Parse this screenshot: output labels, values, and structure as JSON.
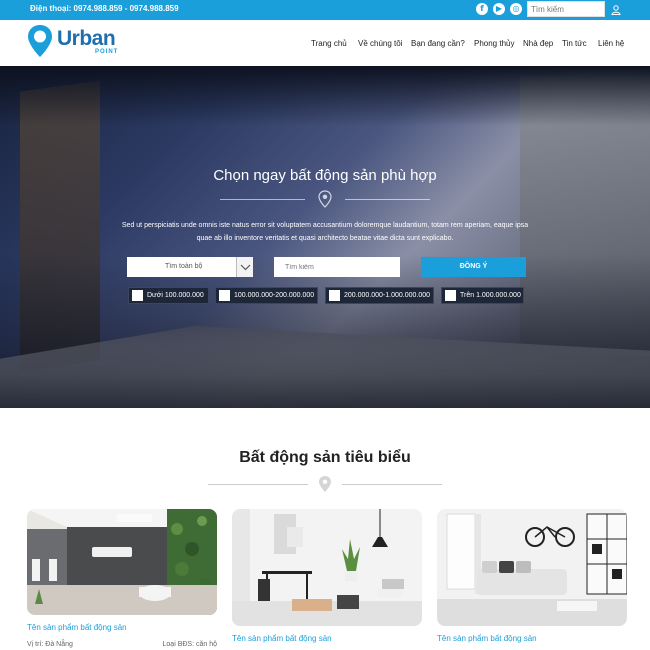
{
  "topbar": {
    "phone": "Điện thoại: 0974.988.859 - 0974.988.859",
    "social_icons": [
      "facebook-icon",
      "youtube-icon",
      "instagram-icon"
    ],
    "search_placeholder": "Tìm kiếm"
  },
  "brand": {
    "name": "Urban",
    "sub": "POINT"
  },
  "nav": [
    "Trang chủ",
    "Về chúng tôi",
    "Bạn đang cần?",
    "Phong thủy",
    "Nhà đẹp",
    "Tin tức",
    "Liên hệ"
  ],
  "hero": {
    "title": "Chọn ngay bất động sản phù hợp",
    "description": "Sed ut perspiciatis unde omnis iste natus error sit voluptatem accusantium doloremque laudantium, totam rem aperiam, eaque ipsa quae ab illo inventore veritatis et quasi architecto beatae vitae dicta sunt explicabo.",
    "select_value": "Tìm toàn bộ",
    "search_placeholder": "Tìm kiếm",
    "button": "ĐỒNG Ý",
    "prices": [
      "Dưới 100.000.000",
      "100.000.000-200.000.000",
      "200.000.000-1.000.000.000",
      "Trên 1.000.000.000"
    ]
  },
  "section": {
    "title": "Bất động sản tiêu biểu",
    "cards": [
      {
        "name": "Tên sản phẩm bất động sản",
        "location": "Vị trí: Đà Nẵng",
        "type": "Loại BĐS: căn hộ"
      },
      {
        "name": "Tên sản phẩm bất động sản"
      },
      {
        "name": "Tên sản phẩm bất động sản"
      }
    ]
  },
  "colors": {
    "accent": "#1a9fdb",
    "brand": "#1f6fae"
  }
}
